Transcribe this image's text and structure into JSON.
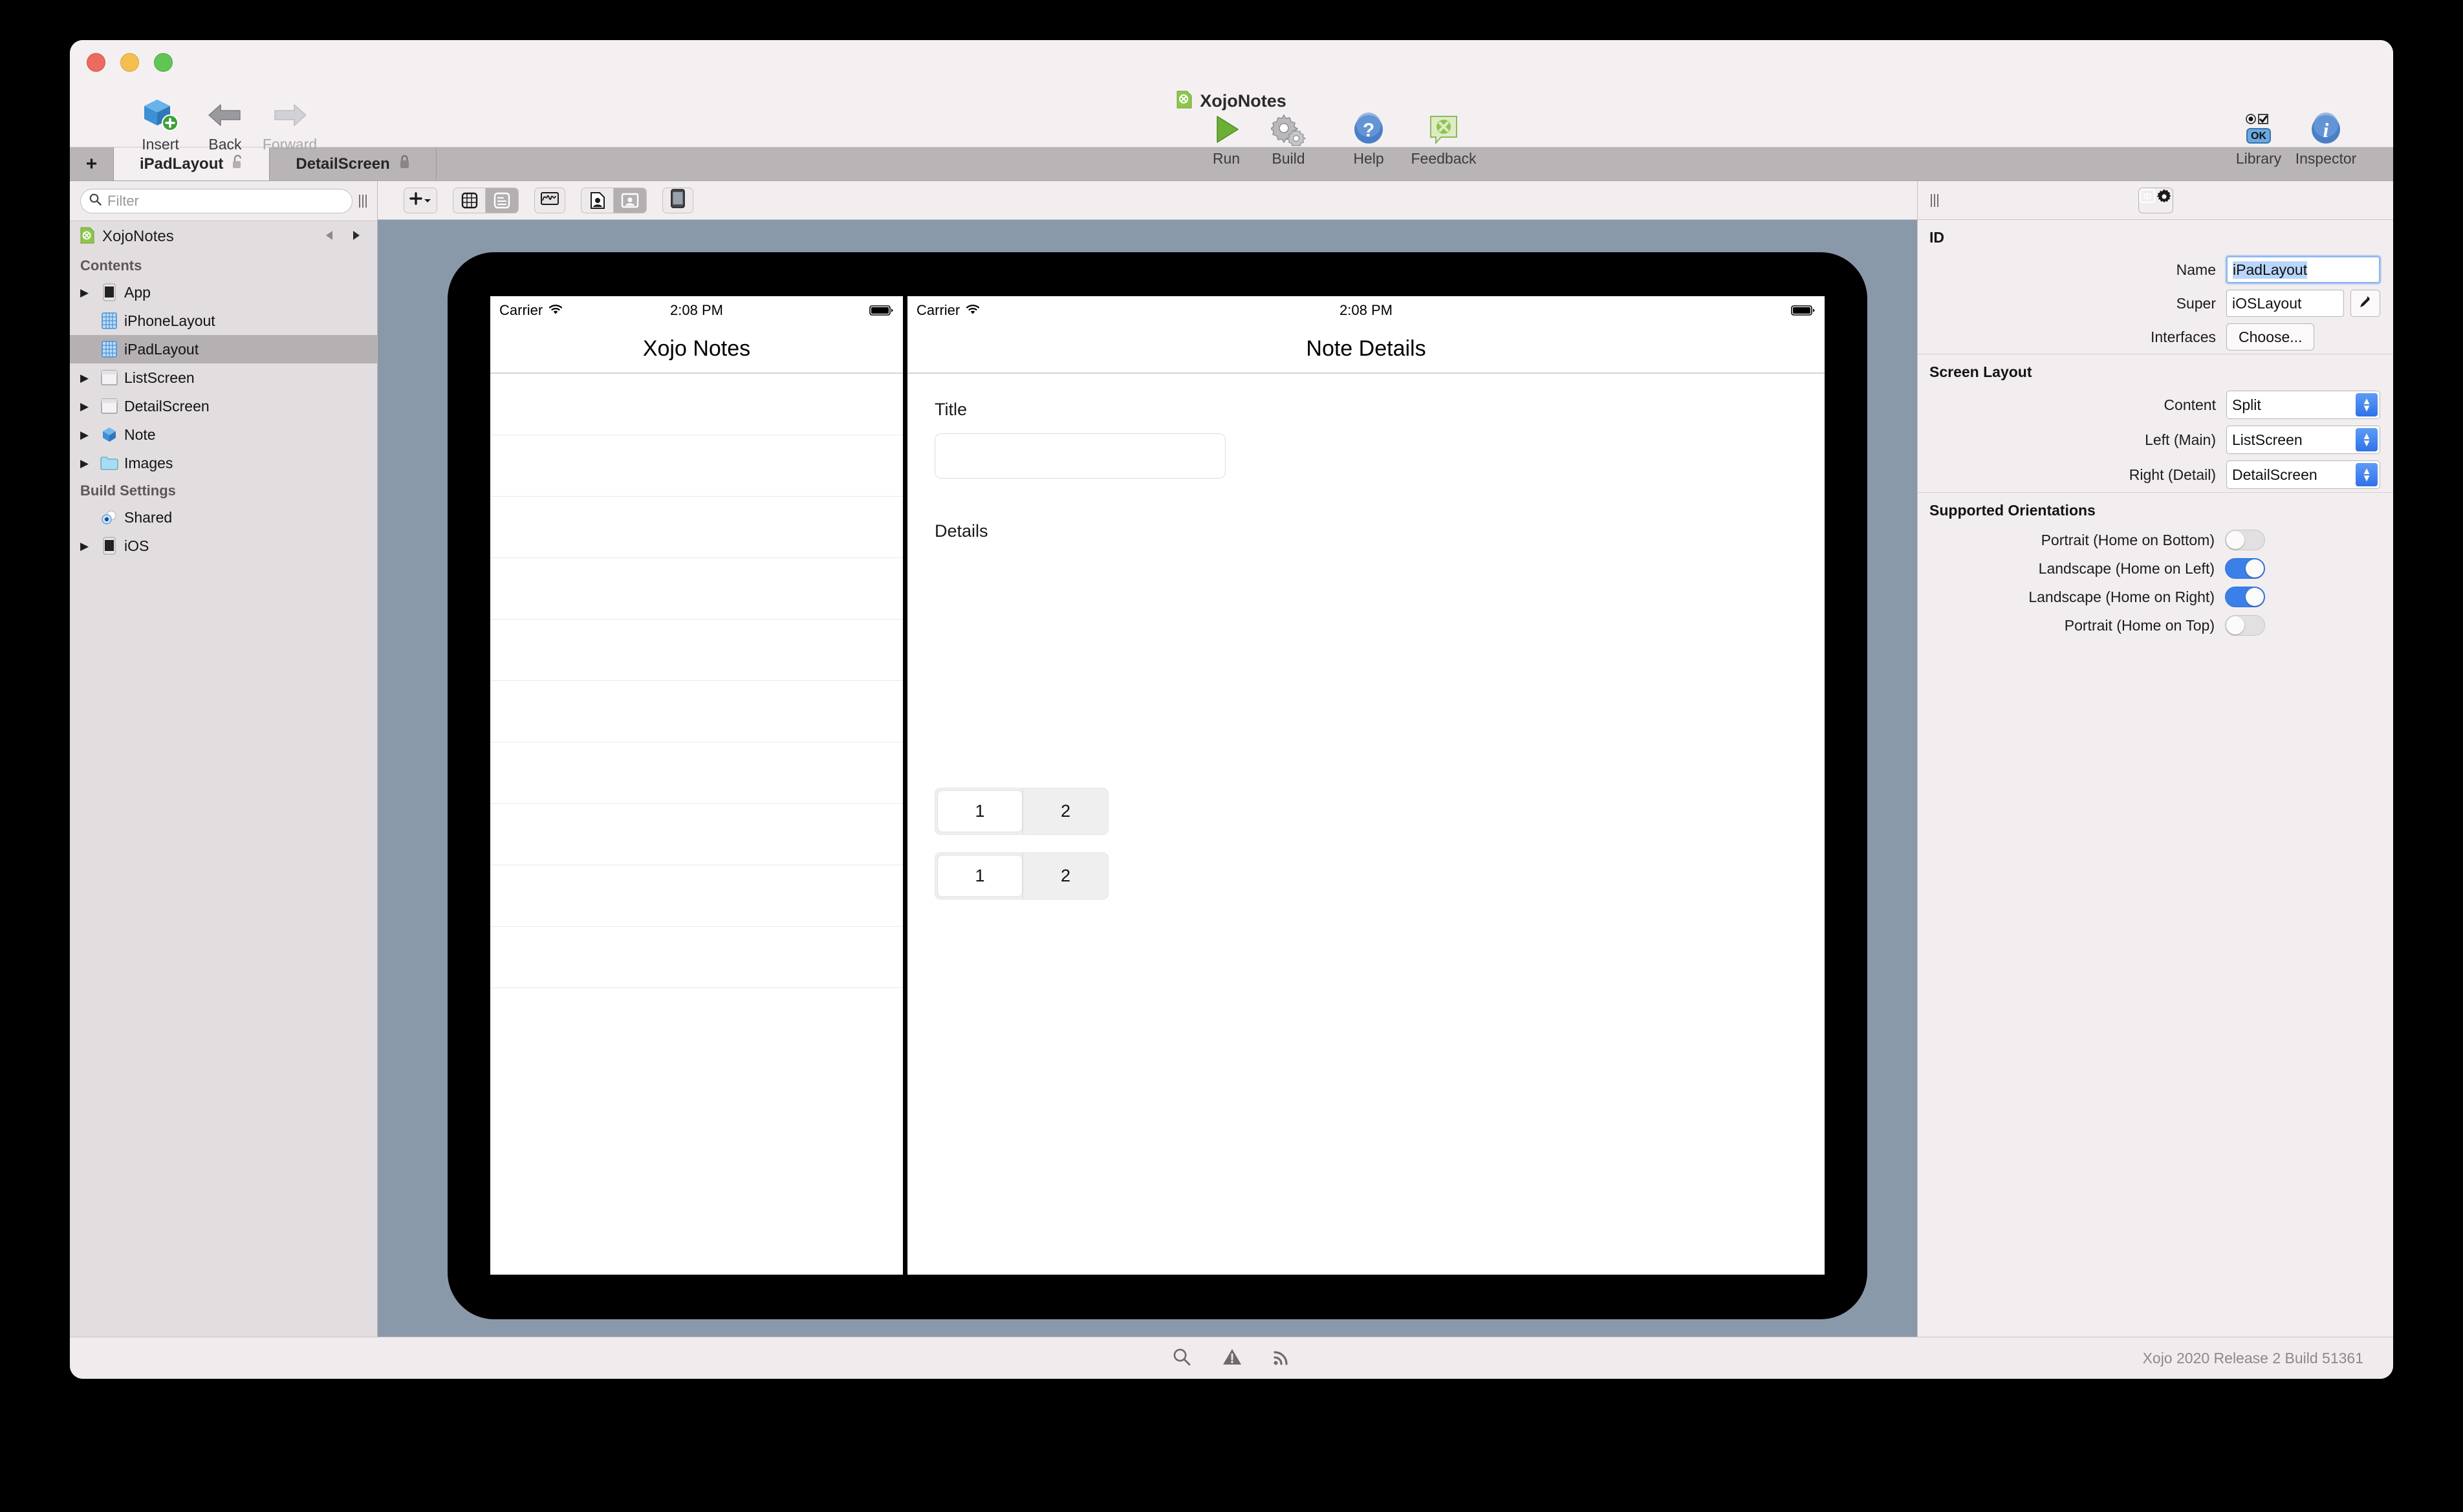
{
  "window": {
    "app_title": "XojoNotes"
  },
  "toolbar": {
    "left_items": [
      {
        "label": "Insert",
        "icon": "insert-cube-icon",
        "enabled": true
      },
      {
        "label": "Back",
        "icon": "back-arrow-icon",
        "enabled": true
      },
      {
        "label": "Forward",
        "icon": "forward-arrow-icon",
        "enabled": false
      }
    ],
    "center_items": [
      {
        "label": "Run",
        "icon": "run-play-icon"
      },
      {
        "label": "Build",
        "icon": "build-gears-icon"
      }
    ],
    "center2_items": [
      {
        "label": "Help",
        "icon": "help-question-icon"
      },
      {
        "label": "Feedback",
        "icon": "feedback-speech-icon"
      }
    ],
    "right_items": [
      {
        "label": "Library",
        "icon": "library-controls-icon"
      },
      {
        "label": "Inspector",
        "icon": "inspector-info-icon"
      }
    ]
  },
  "tabs": {
    "add_label": "+",
    "items": [
      {
        "label": "iPadLayout",
        "active": true,
        "lock": "unlocked-icon"
      },
      {
        "label": "DetailScreen",
        "active": false,
        "lock": "locked-icon"
      }
    ]
  },
  "navigator": {
    "filter_placeholder": "Filter",
    "project_name": "XojoNotes",
    "sections": [
      {
        "title": "Contents",
        "items": [
          {
            "label": "App",
            "icon": "device-phone-icon",
            "disclosure": true,
            "selected": false
          },
          {
            "label": "iPhoneLayout",
            "icon": "layout-grid-icon",
            "disclosure": false,
            "selected": false
          },
          {
            "label": "iPadLayout",
            "icon": "layout-grid-icon",
            "disclosure": false,
            "selected": true
          },
          {
            "label": "ListScreen",
            "icon": "screen-icon",
            "disclosure": true,
            "selected": false
          },
          {
            "label": "DetailScreen",
            "icon": "screen-icon",
            "disclosure": true,
            "selected": false
          },
          {
            "label": "Note",
            "icon": "class-cube-icon",
            "disclosure": true,
            "selected": false
          },
          {
            "label": "Images",
            "icon": "folder-icon",
            "disclosure": true,
            "selected": false
          }
        ]
      },
      {
        "title": "Build Settings",
        "items": [
          {
            "label": "Shared",
            "icon": "shared-target-icon",
            "disclosure": false,
            "selected": false
          },
          {
            "label": "iOS",
            "icon": "device-phone-icon",
            "disclosure": true,
            "selected": false
          }
        ]
      }
    ]
  },
  "editor_toolbar": {
    "add_control_label": "+",
    "buttons": [
      {
        "name": "add-control-button",
        "icon": "plus-dropdown-icon"
      },
      {
        "name": "view-mode-segment",
        "icons": [
          "grid-view-icon",
          "list-view-icon"
        ],
        "selected_index": 1
      },
      {
        "name": "waveform-button",
        "icon": "waveform-icon"
      },
      {
        "name": "asset-segment",
        "icons": [
          "document-person-icon",
          "image-person-icon"
        ],
        "selected_index": 1
      },
      {
        "name": "device-preview-button",
        "icon": "device-icon"
      }
    ]
  },
  "canvas": {
    "left_pane": {
      "status": {
        "carrier": "Carrier",
        "time": "2:08 PM",
        "wifi": "wifi-icon",
        "battery": "battery-icon"
      },
      "nav_title": "Xojo Notes",
      "row_count": 10
    },
    "right_pane": {
      "status": {
        "carrier": "Carrier",
        "time": "2:08 PM",
        "wifi": "wifi-icon",
        "battery": "battery-icon"
      },
      "nav_title": "Note Details",
      "title_label": "Title",
      "title_field_value": "",
      "details_label": "Details",
      "segments": [
        {
          "options": [
            "1",
            "2"
          ],
          "selected_index": 0
        },
        {
          "options": [
            "1",
            "2"
          ],
          "selected_index": 0
        }
      ]
    }
  },
  "inspector": {
    "tabs": [
      {
        "icon": "id-card-icon",
        "selected": true
      },
      {
        "icon": "gear-icon",
        "selected": false
      }
    ],
    "sections": [
      {
        "title": "ID",
        "rows": [
          {
            "label": "Name",
            "type": "text",
            "value": "iPadLayout",
            "focused": true
          },
          {
            "label": "Super",
            "type": "text_with_edit",
            "value": "iOSLayout",
            "edit_icon": "pencil-icon"
          },
          {
            "label": "Interfaces",
            "type": "button",
            "value": "Choose..."
          }
        ]
      },
      {
        "title": "Screen Layout",
        "rows": [
          {
            "label": "Content",
            "type": "popup",
            "value": "Split"
          },
          {
            "label": "Left (Main)",
            "type": "popup",
            "value": "ListScreen"
          },
          {
            "label": "Right (Detail)",
            "type": "popup",
            "value": "DetailScreen"
          }
        ]
      },
      {
        "title": "Supported Orientations",
        "switches": [
          {
            "label": "Portrait (Home on Bottom)",
            "on": false
          },
          {
            "label": "Landscape (Home on Left)",
            "on": true
          },
          {
            "label": "Landscape (Home on Right)",
            "on": true
          },
          {
            "label": "Portrait (Home on Top)",
            "on": false
          }
        ]
      }
    ]
  },
  "status_bar": {
    "icons": [
      "search-icon",
      "warning-icon",
      "broadcast-icon"
    ],
    "build_version": "Xojo 2020 Release 2 Build 51361"
  },
  "colors": {
    "canvas_bg": "#8a99aa",
    "accent_blue": "#3b7fe8",
    "chrome": "#f2eef0"
  }
}
